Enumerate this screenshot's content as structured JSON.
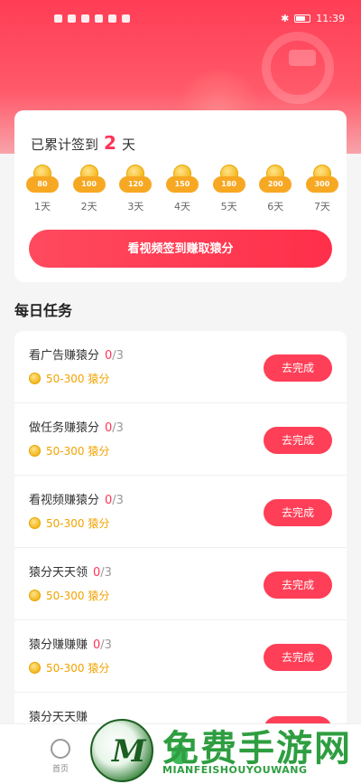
{
  "status_bar": {
    "time": "11:39"
  },
  "signin": {
    "prefix": "已累计签到",
    "days": "2",
    "suffix": "天",
    "coins": [
      {
        "value": "80",
        "day": "1天"
      },
      {
        "value": "100",
        "day": "2天"
      },
      {
        "value": "120",
        "day": "3天"
      },
      {
        "value": "150",
        "day": "4天"
      },
      {
        "value": "180",
        "day": "5天"
      },
      {
        "value": "200",
        "day": "6天"
      },
      {
        "value": "300",
        "day": "7天"
      }
    ],
    "watch_button": "看视频签到赚取猿分"
  },
  "daily_tasks": {
    "title": "每日任务",
    "items": [
      {
        "name": "看广告赚猿分",
        "current": "0",
        "total": "/3",
        "reward": "50-300 猿分",
        "action": "去完成"
      },
      {
        "name": "做任务赚猿分",
        "current": "0",
        "total": "/3",
        "reward": "50-300 猿分",
        "action": "去完成"
      },
      {
        "name": "看视频赚猿分",
        "current": "0",
        "total": "/3",
        "reward": "50-300 猿分",
        "action": "去完成"
      },
      {
        "name": "猿分天天领",
        "current": "0",
        "total": "/3",
        "reward": "50-300 猿分",
        "action": "去完成"
      },
      {
        "name": "猿分赚赚赚",
        "current": "0",
        "total": "/3",
        "reward": "50-300 猿分",
        "action": "去完成"
      },
      {
        "name": "猿分天天赚",
        "current": "",
        "total": "",
        "reward": "",
        "action": "去完成"
      }
    ]
  },
  "bottom_nav": {
    "home_label": "首页"
  },
  "watermark": {
    "title": "免费手游网",
    "subtitle": "MIANFEISHOUYOUWANG"
  },
  "colors": {
    "accent": "#ff3f57",
    "reward": "#f2a300",
    "brand_green": "#2e9e40"
  }
}
